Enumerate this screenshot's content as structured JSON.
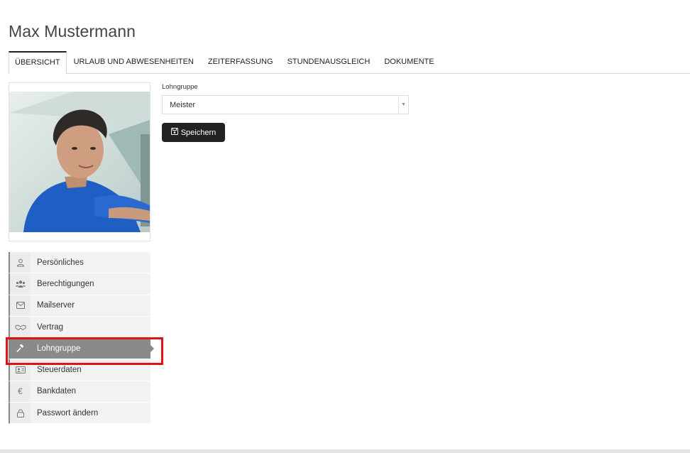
{
  "page": {
    "title": "Max Mustermann"
  },
  "tabs": [
    {
      "label": "ÜBERSICHT",
      "active": true
    },
    {
      "label": "URLAUB UND ABWESENHEITEN"
    },
    {
      "label": "ZEITERFASSUNG"
    },
    {
      "label": "STUNDENAUSGLEICH"
    },
    {
      "label": "DOKUMENTE"
    }
  ],
  "side_menu": {
    "items": [
      {
        "label": "Persönliches",
        "icon": "user-icon"
      },
      {
        "label": "Berechtigungen",
        "icon": "users-icon"
      },
      {
        "label": "Mailserver",
        "icon": "envelope-icon"
      },
      {
        "label": "Vertrag",
        "icon": "handshake-icon"
      },
      {
        "label": "Lohngruppe",
        "icon": "gavel-icon",
        "active": true
      },
      {
        "label": "Steuerdaten",
        "icon": "id-card-icon"
      },
      {
        "label": "Bankdaten",
        "icon": "euro-icon"
      },
      {
        "label": "Passwort ändern",
        "icon": "lock-icon"
      }
    ]
  },
  "form": {
    "field_label": "Lohngruppe",
    "select_value": "Meister",
    "save_label": "Speichern"
  },
  "colors": {
    "active_item": "#8a8a8a",
    "highlight": "#e11212",
    "button": "#222222"
  }
}
